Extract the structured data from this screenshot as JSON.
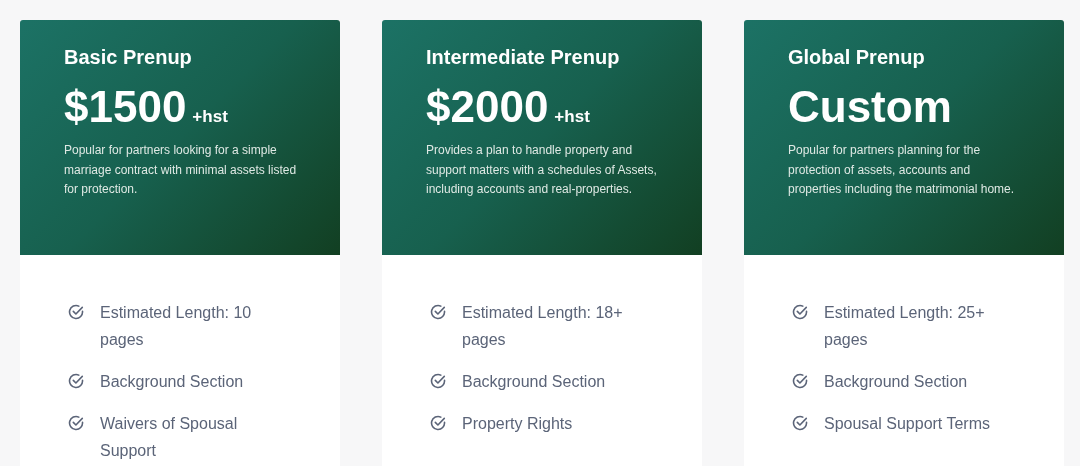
{
  "plans": [
    {
      "title": "Basic Prenup",
      "price": "$1500",
      "price_suffix": "+hst",
      "description": "Popular for partners looking for a simple marriage contract with minimal assets listed for protection.",
      "features": [
        "Estimated Length: 10 pages",
        "Background Section",
        "Waivers of Spousal Support"
      ]
    },
    {
      "title": "Intermediate Prenup",
      "price": "$2000",
      "price_suffix": "+hst",
      "description": "Provides a plan to handle property and support matters with a schedules of Assets, including accounts and real-properties.",
      "features": [
        "Estimated Length: 18+ pages",
        "Background Section",
        "Property Rights"
      ]
    },
    {
      "title": "Global Prenup",
      "price": "Custom",
      "description": "Popular for partners planning for the protection of assets, accounts and properties including the matrimonial home.",
      "features": [
        "Estimated Length: 25+ pages",
        "Background Section",
        "Spousal Support Terms"
      ]
    }
  ]
}
